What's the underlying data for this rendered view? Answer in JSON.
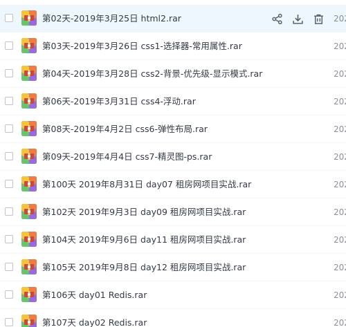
{
  "colors": {
    "hover_bg": "#eef6fe",
    "text": "#333a45",
    "muted": "#8a8f99",
    "icon": "#5b6170"
  },
  "file_icon": "rar-archive-icon",
  "row_actions": [
    {
      "name": "share-icon"
    },
    {
      "name": "download-icon"
    },
    {
      "name": "delete-icon"
    }
  ],
  "files": [
    {
      "name": "第02天-2019年3月25日 html2.rar",
      "date": "202",
      "hover": true
    },
    {
      "name": "第03天-2019年3月26日 css1-选择器-常用属性.rar",
      "date": "202"
    },
    {
      "name": "第04天-2019年3月28日 css2-背景-优先级-显示模式.rar",
      "date": "202"
    },
    {
      "name": "第06天-2019年3月31日 css4-浮动.rar",
      "date": "202"
    },
    {
      "name": "第08天-2019年4月2日 css6-弹性布局.rar",
      "date": "202"
    },
    {
      "name": "第09天-2019年4月4日 css7-精灵图-ps.rar",
      "date": "202"
    },
    {
      "name": "第100天 2019年8月31日 day07 租房网项目实战.rar",
      "date": "202"
    },
    {
      "name": "第102天 2019年9月3日 day09 租房网项目实战.rar",
      "date": "202"
    },
    {
      "name": "第104天 2019年9月6日 day11 租房网项目实战.rar",
      "date": "202"
    },
    {
      "name": "第105天 2019年9月8日 day12 租房网项目实战.rar",
      "date": "202"
    },
    {
      "name": "第106天 day01 Redis.rar",
      "date": "202"
    },
    {
      "name": "第107天 day02 Redis.rar",
      "date": "202"
    }
  ]
}
